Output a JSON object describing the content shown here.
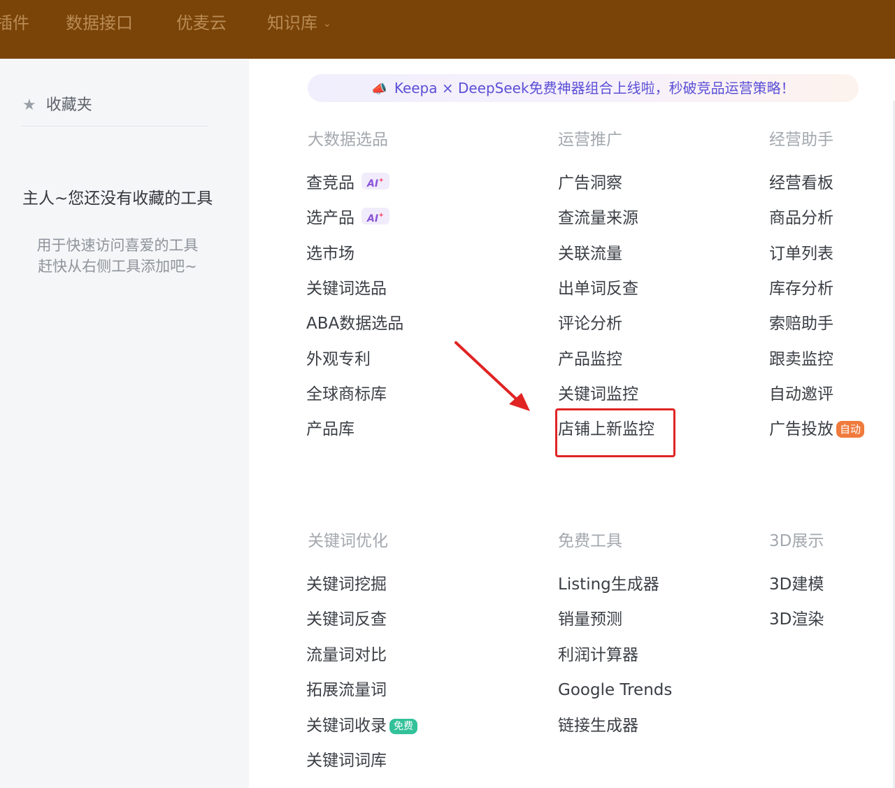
{
  "topnav": {
    "items": [
      {
        "label": "插件"
      },
      {
        "label": "数据接口"
      },
      {
        "label": "优麦云"
      },
      {
        "label": "知识库",
        "has_dropdown": true
      }
    ]
  },
  "sidebar": {
    "title": "收藏夹",
    "empty_title": "主人~您还没有收藏的工具",
    "empty_desc_line1": "用于快速访问喜爱的工具",
    "empty_desc_line2": "赶快从右侧工具添加吧~"
  },
  "banner": {
    "text": "Keepa × DeepSeek免费神器组合上线啦，秒破竞品运营策略！"
  },
  "sections": {
    "bigdata": {
      "title": "大数据选品",
      "items": [
        "查竞品",
        "选产品",
        "选市场",
        "关键词选品",
        "ABA数据选品",
        "外观专利",
        "全球商标库",
        "产品库"
      ]
    },
    "promo": {
      "title": "运营推广",
      "items": [
        "广告洞察",
        "查流量来源",
        "关联流量",
        "出单词反查",
        "评论分析",
        "产品监控",
        "关键词监控",
        "店铺上新监控"
      ]
    },
    "ops": {
      "title": "经营助手",
      "items": [
        "经营看板",
        "商品分析",
        "订单列表",
        "库存分析",
        "索赔助手",
        "跟卖监控",
        "自动邀评",
        "广告投放"
      ]
    },
    "keyword": {
      "title": "关键词优化",
      "items": [
        "关键词挖掘",
        "关键词反查",
        "流量词对比",
        "拓展流量词",
        "关键词收录",
        "关键词词库"
      ]
    },
    "free": {
      "title": "免费工具",
      "items": [
        "Listing生成器",
        "销量预测",
        "利润计算器",
        "Google Trends",
        "链接生成器"
      ]
    },
    "threed": {
      "title": "3D展示",
      "items": [
        "3D建模",
        "3D渲染"
      ]
    }
  },
  "badges": {
    "ai": "AI",
    "auto": "自动",
    "free": "免费"
  },
  "colors": {
    "topbar": "#7a4408",
    "banner_text": "#5b4fd6",
    "highlight": "#e02424"
  }
}
